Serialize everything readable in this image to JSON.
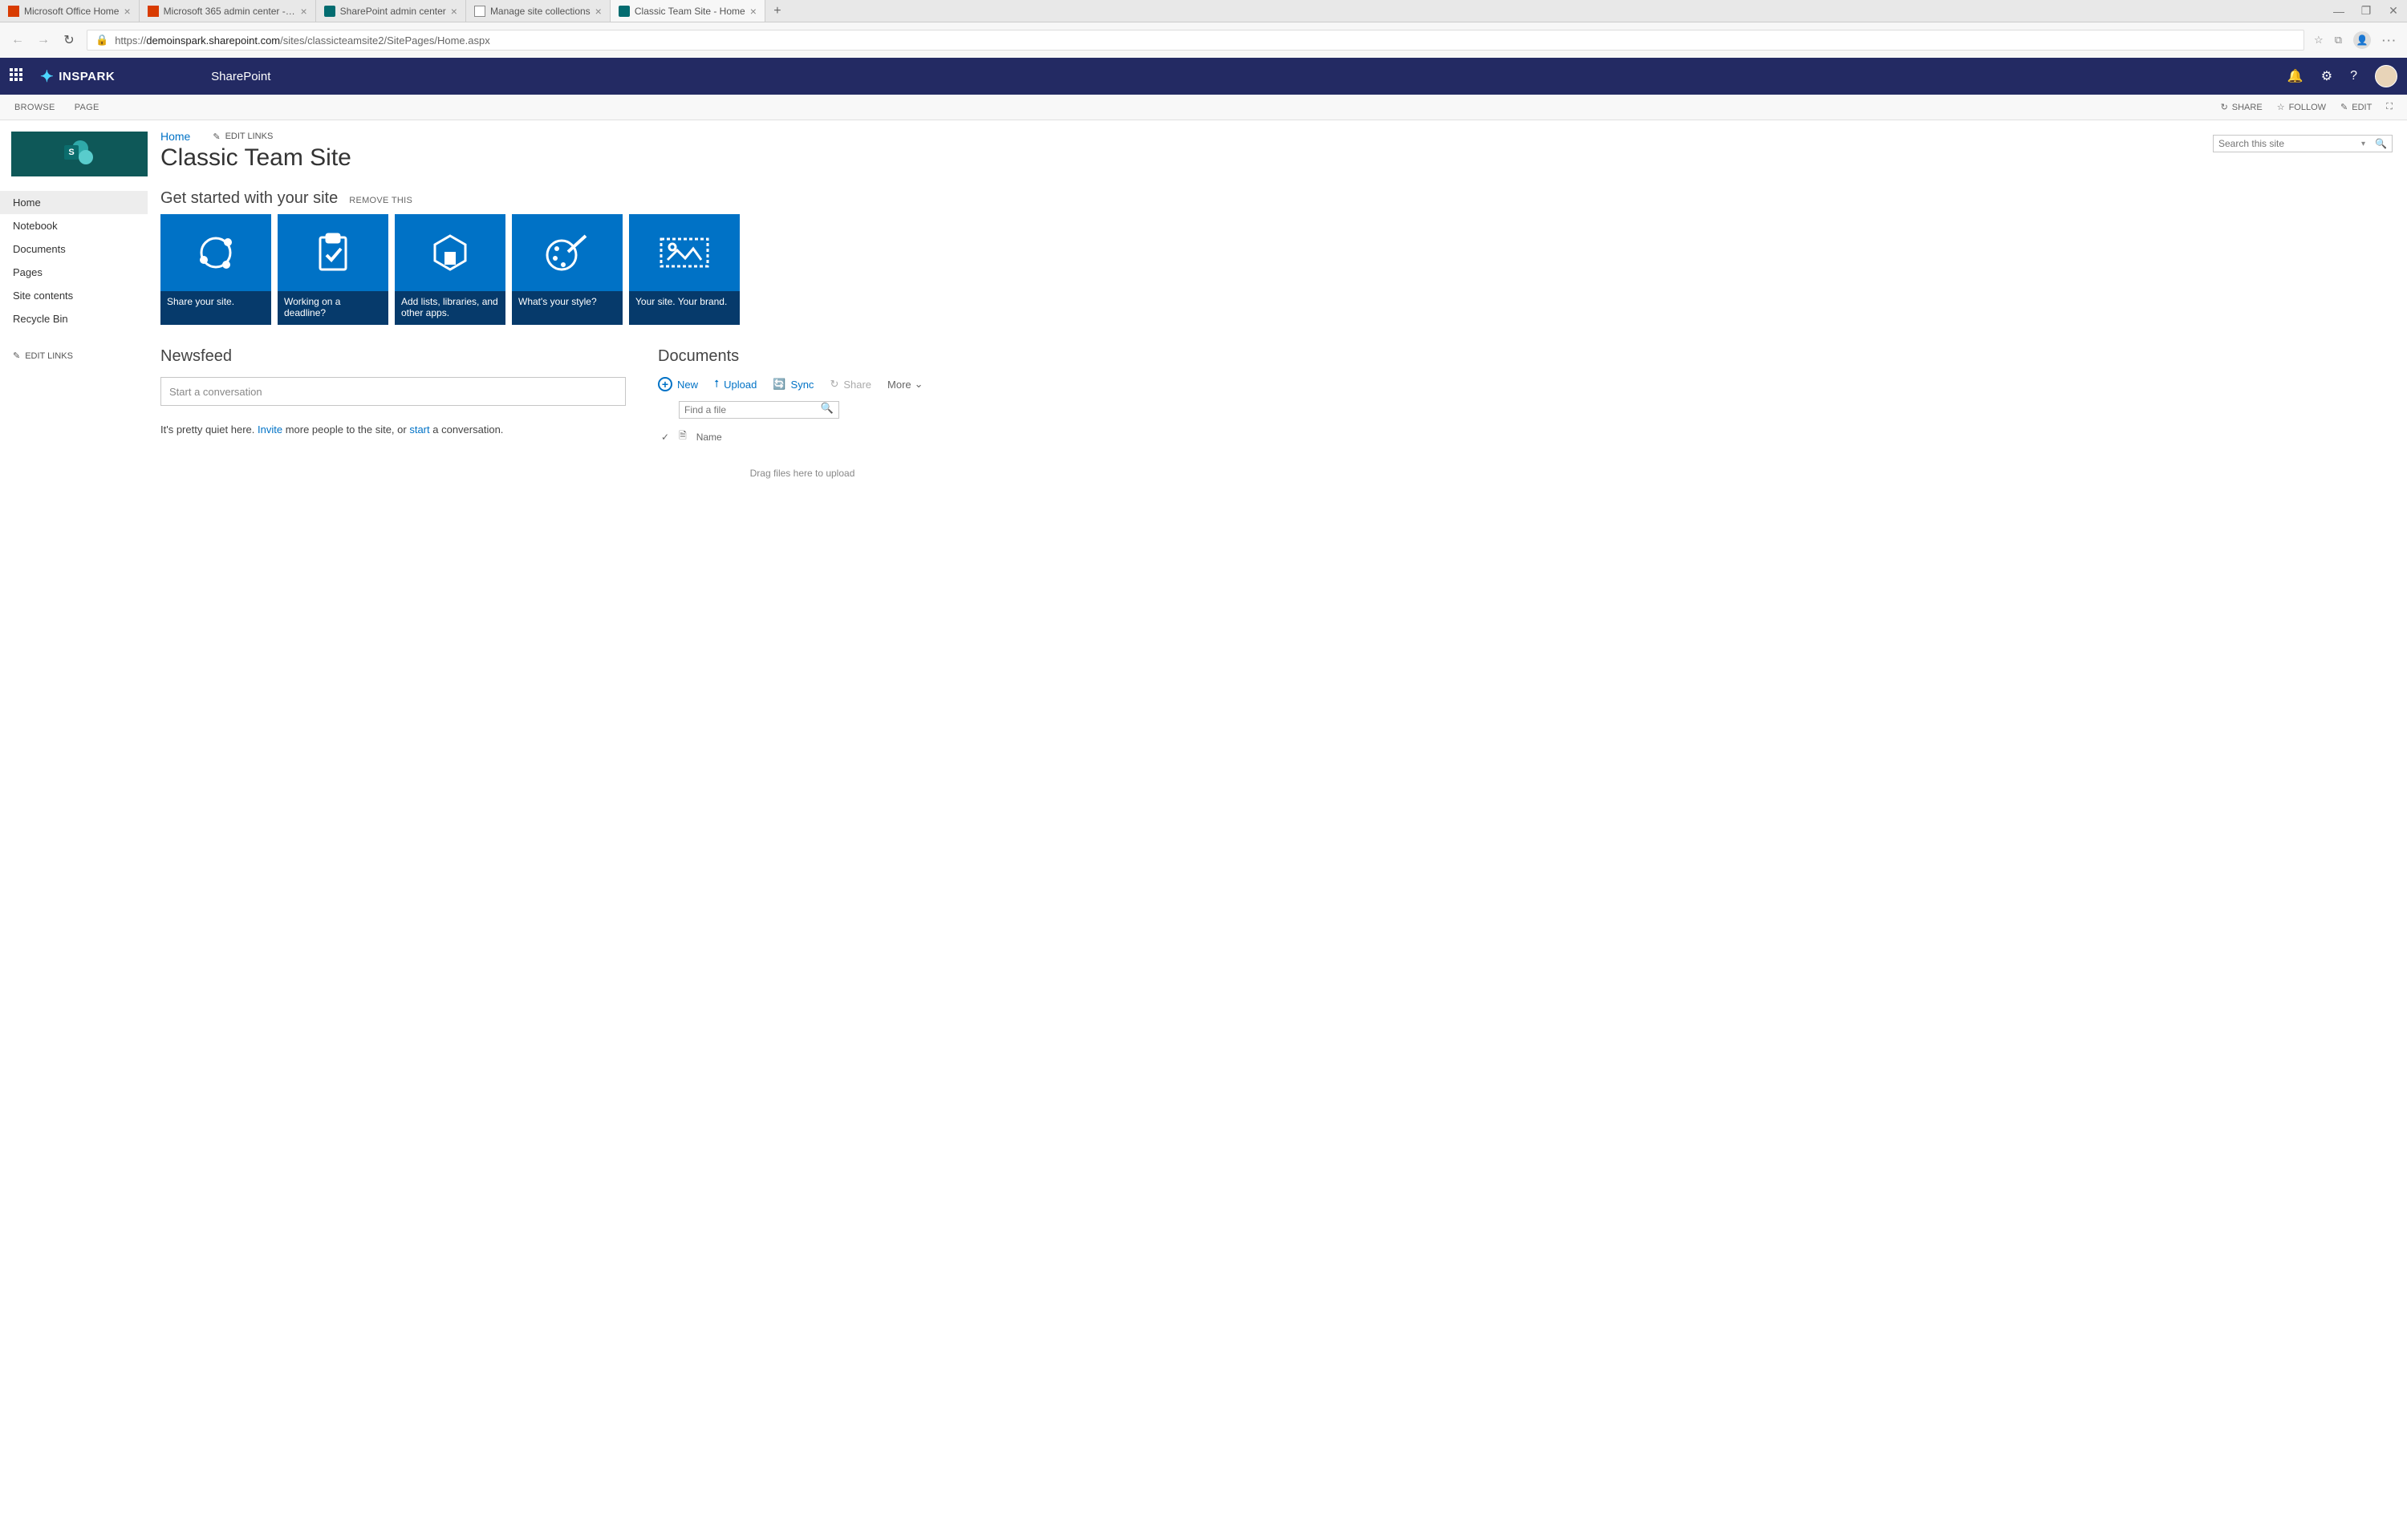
{
  "browser": {
    "tabs": [
      {
        "title": "Microsoft Office Home",
        "icon": "office"
      },
      {
        "title": "Microsoft 365 admin center - M…",
        "icon": "office"
      },
      {
        "title": "SharePoint admin center",
        "icon": "sp"
      },
      {
        "title": "Manage site collections",
        "icon": "page"
      },
      {
        "title": "Classic Team Site - Home",
        "icon": "sp",
        "active": true
      }
    ],
    "url_prefix": "https://",
    "url_domain": "demoinspark.sharepoint.com",
    "url_path": "/sites/classicteamsite2/SitePages/Home.aspx"
  },
  "suite": {
    "brand": "INSPARK",
    "app": "SharePoint"
  },
  "ribbon": {
    "tabs": [
      "BROWSE",
      "PAGE"
    ],
    "actions": {
      "share": "SHARE",
      "follow": "FOLLOW",
      "edit": "EDIT"
    }
  },
  "breadcrumb": {
    "home": "Home",
    "edit": "EDIT LINKS"
  },
  "page_title": "Classic Team Site",
  "search": {
    "placeholder": "Search this site"
  },
  "quicklaunch": {
    "items": [
      "Home",
      "Notebook",
      "Documents",
      "Pages",
      "Site contents",
      "Recycle Bin"
    ],
    "active": 0,
    "edit": "EDIT LINKS"
  },
  "getstarted": {
    "heading": "Get started with your site",
    "remove": "REMOVE THIS",
    "tiles": [
      "Share your site.",
      "Working on a deadline?",
      "Add lists, libraries, and other apps.",
      "What's your style?",
      "Your site. Your brand."
    ]
  },
  "newsfeed": {
    "heading": "Newsfeed",
    "placeholder": "Start a conversation",
    "quiet_pre": "It's pretty quiet here. ",
    "invite": "Invite",
    "quiet_mid": " more people to the site, or ",
    "start": "start",
    "quiet_post": " a conversation."
  },
  "documents": {
    "heading": "Documents",
    "new": "New",
    "upload": "Upload",
    "sync": "Sync",
    "share": "Share",
    "more": "More",
    "find_placeholder": "Find a file",
    "name_col": "Name",
    "empty": "Drag files here to upload"
  }
}
